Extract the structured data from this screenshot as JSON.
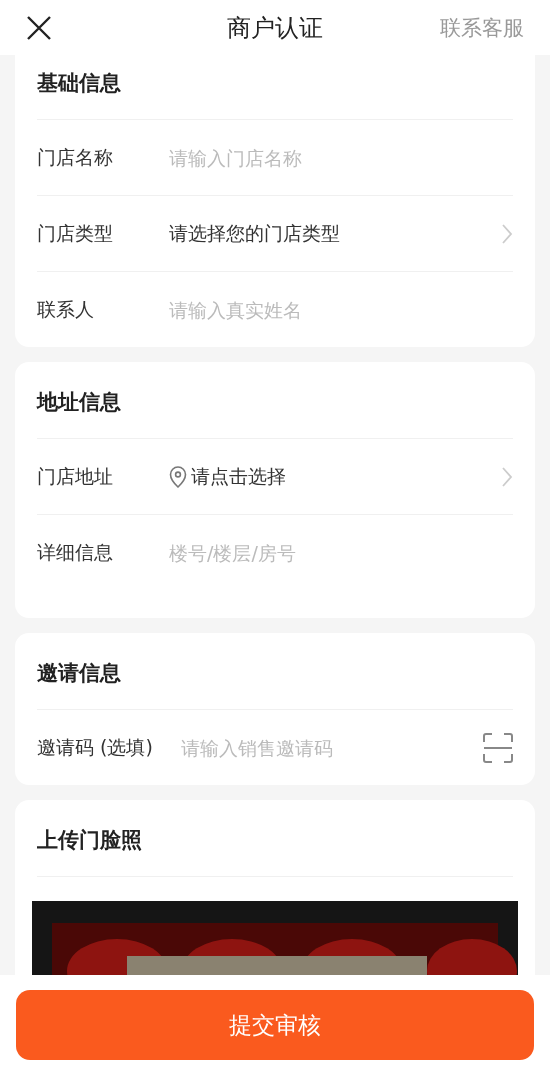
{
  "header": {
    "title": "商户认证",
    "action": "联系客服"
  },
  "sections": [
    {
      "title": "基础信息",
      "fields": [
        {
          "kind": "text",
          "label": "门店名称",
          "placeholder": "请输入门店名称"
        },
        {
          "kind": "select",
          "label": "门店类型",
          "value": "请选择您的门店类型"
        },
        {
          "kind": "text",
          "label": "联系人",
          "placeholder": "请输入真实姓名"
        }
      ]
    },
    {
      "title": "地址信息",
      "fields": [
        {
          "kind": "location",
          "label": "门店地址",
          "value": "请点击选择"
        },
        {
          "kind": "text",
          "label": "详细信息",
          "placeholder": "楼号/楼层/房号"
        }
      ]
    },
    {
      "title": "邀请信息",
      "fields": [
        {
          "kind": "scan",
          "label": "邀请码 (选填)",
          "placeholder": "请输入销售邀请码"
        }
      ]
    },
    {
      "title": "上传门脸照"
    }
  ],
  "submit": "提交审核"
}
